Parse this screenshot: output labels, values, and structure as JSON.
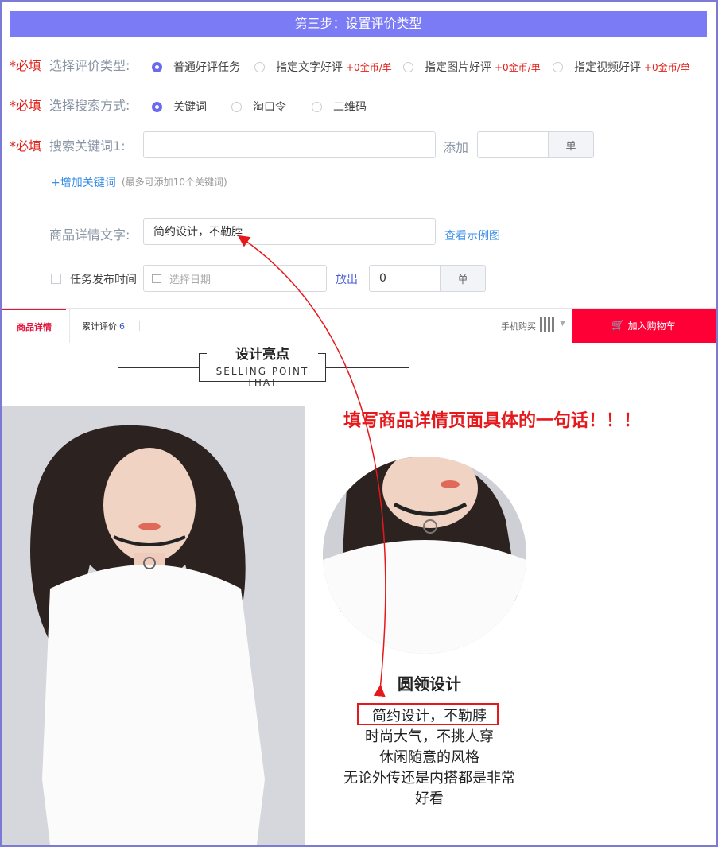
{
  "header": {
    "title": "第三步：设置评价类型"
  },
  "required_mark": "*必填",
  "review_type": {
    "label": "选择评价类型:",
    "options": [
      {
        "label": "普通好评任务",
        "note": "",
        "selected": true
      },
      {
        "label": "指定文字好评",
        "note": "+0金币/单",
        "selected": false
      },
      {
        "label": "指定图片好评",
        "note": "+0金币/单",
        "selected": false
      },
      {
        "label": "指定视频好评",
        "note": "+0金币/单",
        "selected": false
      }
    ]
  },
  "search_method": {
    "label": "选择搜索方式:",
    "options": [
      {
        "label": "关键词",
        "selected": true
      },
      {
        "label": "淘口令",
        "selected": false
      },
      {
        "label": "二维码",
        "selected": false
      }
    ]
  },
  "keyword": {
    "label": "搜索关键词1:",
    "value": "",
    "add_label": "添加",
    "count_value": "",
    "unit": "单",
    "add_keyword_link": "+增加关键词",
    "add_keyword_hint": "(最多可添加10个关键词)"
  },
  "detail_text": {
    "label": "商品详情文字:",
    "value": "简约设计，不勒脖",
    "example_link": "查看示例图"
  },
  "publish": {
    "label": "任务发布时间",
    "date_placeholder": "选择日期",
    "release_label": "放出",
    "count_value": "0",
    "unit": "单"
  },
  "product_page": {
    "tabs": {
      "detail": "商品详情",
      "reviews": "累计评价",
      "reviews_count": "6"
    },
    "mobile_buy": "手机购买",
    "cart_button": "加入购物车",
    "selling_point_title": "设计亮点",
    "selling_point_sub": "SELLING POINT THAT",
    "callout": "填写商品详情页面具体的一句话！！！",
    "feature_title": "圆领设计",
    "feature_lines": [
      "简约设计，不勒脖",
      "时尚大气，不挑人穿",
      "休闲随意的风格",
      "无论外传还是内搭都是非常",
      "好看"
    ]
  },
  "colors": {
    "accent": "#7b7bf5",
    "required": "#e0201b",
    "cart": "#ff0036",
    "link": "#3a8ee6"
  },
  "icons": [
    "calendar-icon",
    "qr-code-icon",
    "cart-icon",
    "chevron-down-icon"
  ]
}
